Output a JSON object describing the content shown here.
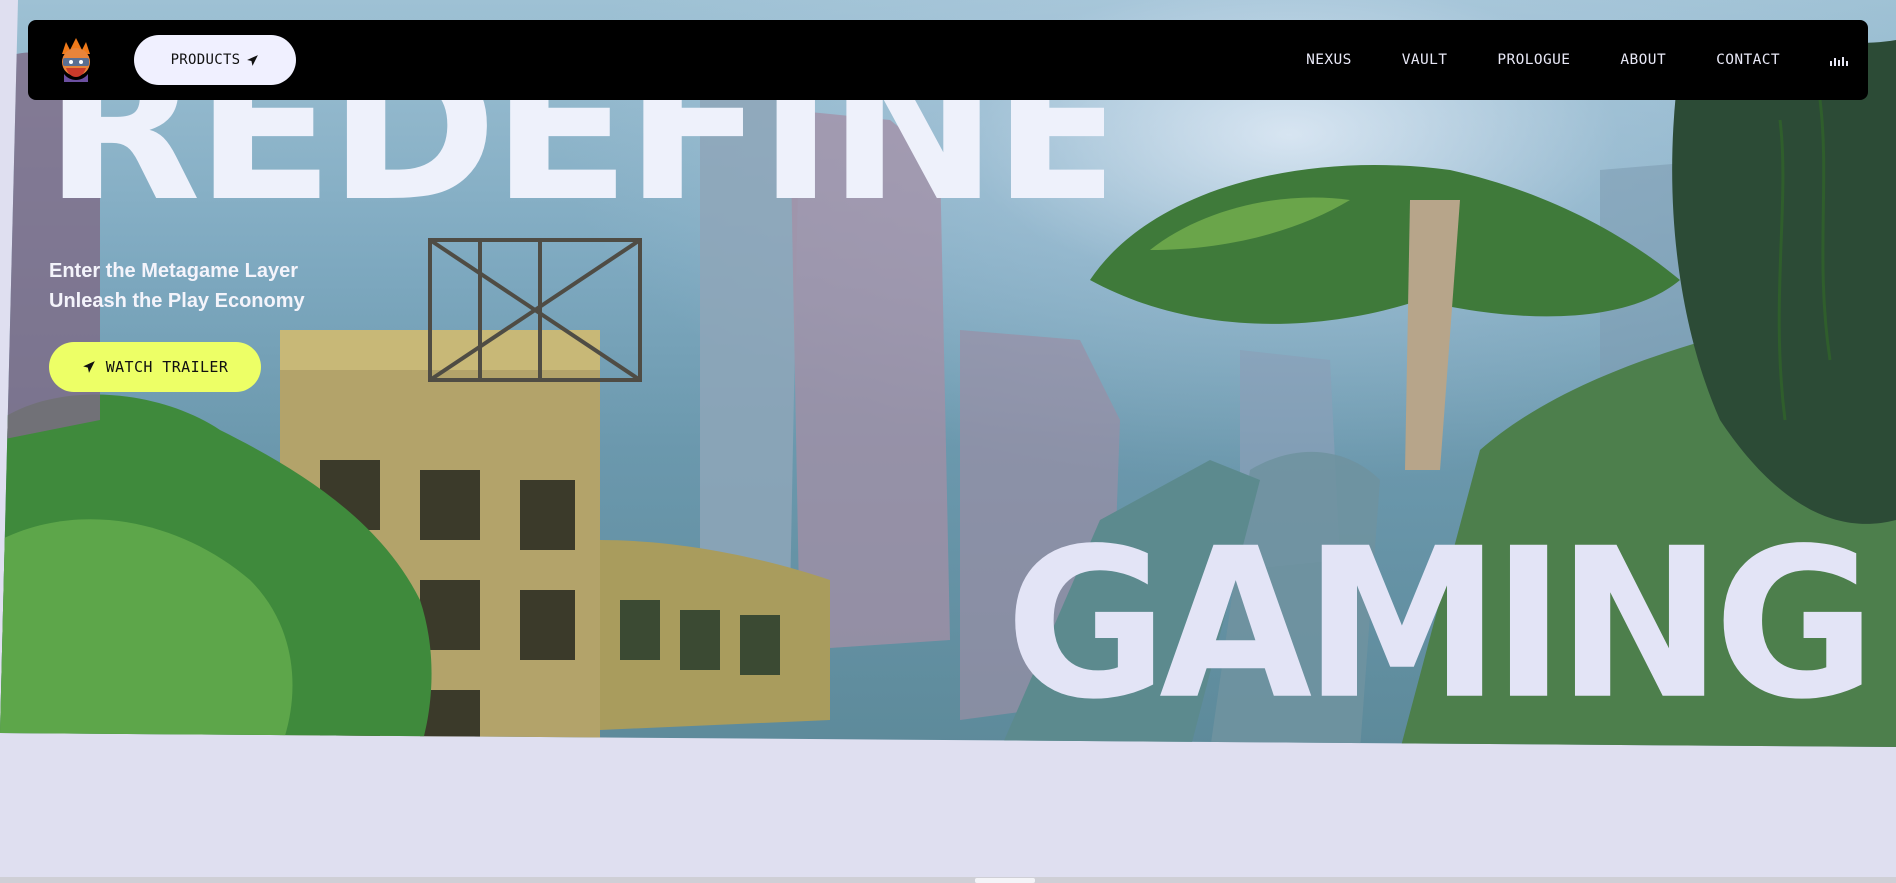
{
  "navbar": {
    "logo_icon": "ninja-avatar-icon",
    "products_label": "PRODUCTS",
    "products_icon": "paper-plane-icon",
    "links": [
      "NEXUS",
      "VAULT",
      "PROLOGUE",
      "ABOUT",
      "CONTACT"
    ],
    "audio_icon": "audio-bars-icon"
  },
  "hero": {
    "title_top": "REDEFINE",
    "tagline_line1": "Enter the Metagame Layer",
    "tagline_line2": "Unleash the Play Economy",
    "cta_label": "WATCH TRAILER",
    "cta_icon": "paper-plane-icon",
    "title_bottom": "GAMING"
  },
  "colors": {
    "navbar_bg": "#000000",
    "products_btn_bg": "#f0f0ff",
    "cta_bg": "#edff66",
    "title_color": "#eef1fb",
    "page_bg": "#dfdff0"
  }
}
